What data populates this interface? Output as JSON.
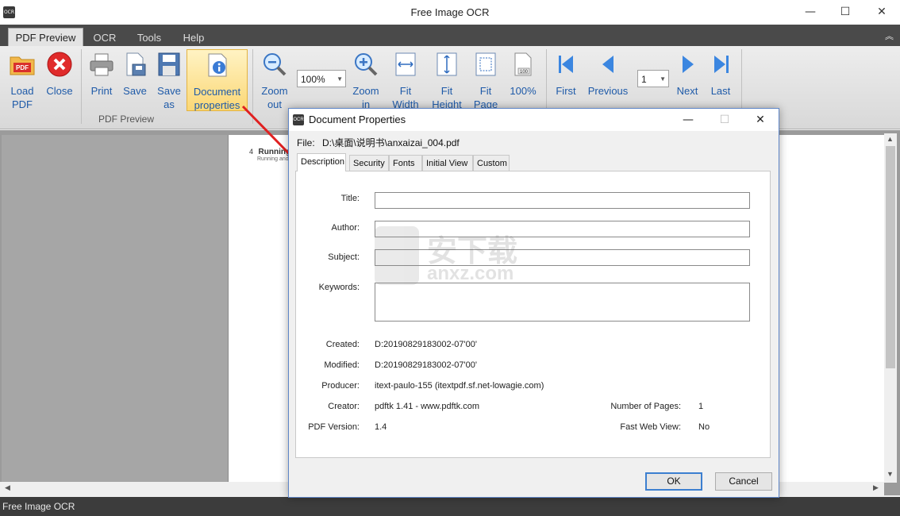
{
  "app": {
    "title": "Free Image OCR",
    "icon_text": "OCR",
    "status": "Free Image OCR"
  },
  "window_controls": {
    "minimize": "—",
    "maximize": "☐",
    "close": "✕",
    "collapse": "︽"
  },
  "tabs": [
    "PDF Preview",
    "OCR",
    "Tools",
    "Help"
  ],
  "ribbon": {
    "load_pdf": [
      "Load",
      "PDF"
    ],
    "close": "Close",
    "print": "Print",
    "save": "Save",
    "save_as": [
      "Save",
      "as"
    ],
    "doc_props": [
      "Document",
      "properties"
    ],
    "zoom_out": [
      "Zoom",
      "out"
    ],
    "zoom_value": "100%",
    "zoom_in": [
      "Zoom",
      "in"
    ],
    "fit_width": [
      "Fit",
      "Width"
    ],
    "fit_height": [
      "Fit",
      "Height"
    ],
    "fit_page": [
      "Fit",
      "Page"
    ],
    "hundred": "100%",
    "first": "First",
    "previous": "Previous",
    "page_value": "1",
    "next": "Next",
    "last": "Last",
    "group_label": "PDF Preview"
  },
  "page_snippet": {
    "num": "4",
    "heading": "Running a",
    "sub": "Running and"
  },
  "dialog": {
    "title": "Document Properties",
    "icon_text": "OCR",
    "file_label": "File:",
    "file_path": "D:\\桌面\\说明书\\anxaizai_004.pdf",
    "tabs": [
      "Description",
      "Security",
      "Fonts",
      "Initial View",
      "Custom"
    ],
    "fields": {
      "title_label": "Title:",
      "author_label": "Author:",
      "subject_label": "Subject:",
      "keywords_label": "Keywords:",
      "created_label": "Created:",
      "created_value": "D:20190829183002-07'00'",
      "modified_label": "Modified:",
      "modified_value": "D:20190829183002-07'00'",
      "producer_label": "Producer:",
      "producer_value": "itext-paulo-155 (itextpdf.sf.net-lowagie.com)",
      "creator_label": "Creator:",
      "creator_value": "pdftk 1.41 - www.pdftk.com",
      "pdf_version_label": "PDF Version:",
      "pdf_version_value": "1.4",
      "num_pages_label": "Number of Pages:",
      "num_pages_value": "1",
      "fast_web_label": "Fast Web View:",
      "fast_web_value": "No"
    },
    "ok": "OK",
    "cancel": "Cancel"
  },
  "watermark": {
    "text": "安下载",
    "sub": "anxz.com"
  },
  "colors": {
    "accent": "#1e5aa8",
    "ribbon_tab_bg": "#4a4a4a",
    "highlight": "#fbd775",
    "arrow": "#e02020"
  }
}
